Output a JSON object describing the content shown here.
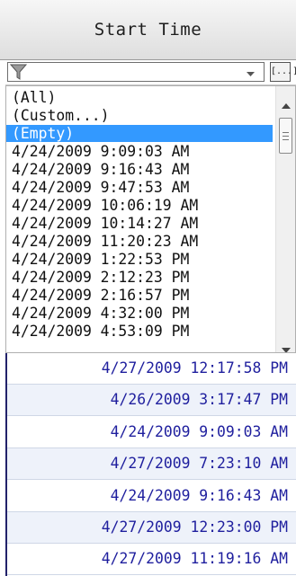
{
  "header": {
    "title": "Start Time"
  },
  "filter": {
    "value": "",
    "ellipsis_label": "[...]"
  },
  "dropdown": {
    "items": [
      "(All)",
      "(Custom...)",
      "(Empty)",
      "4/24/2009 9:09:03 AM",
      "4/24/2009 9:16:43 AM",
      "4/24/2009 9:47:53 AM",
      "4/24/2009 10:06:19 AM",
      "4/24/2009 10:14:27 AM",
      "4/24/2009 11:20:23 AM",
      "4/24/2009 1:22:53 PM",
      "4/24/2009 2:12:23 PM",
      "4/24/2009 2:16:57 PM",
      "4/24/2009 4:32:00 PM",
      "4/24/2009 4:53:09 PM"
    ],
    "selected": "(Empty)"
  },
  "grid": {
    "rows": [
      "4/27/2009 12:17:58 PM",
      "4/26/2009 3:17:47 PM",
      "4/24/2009 9:09:03 AM",
      "4/27/2009 7:23:10 AM",
      "4/24/2009 9:16:43 AM",
      "4/27/2009 12:23:00 PM",
      "4/27/2009 11:19:16 AM"
    ]
  },
  "colors": {
    "selection": "#3399ff",
    "grid_text": "#1f1f9e",
    "alt_row": "#eef2fa"
  }
}
